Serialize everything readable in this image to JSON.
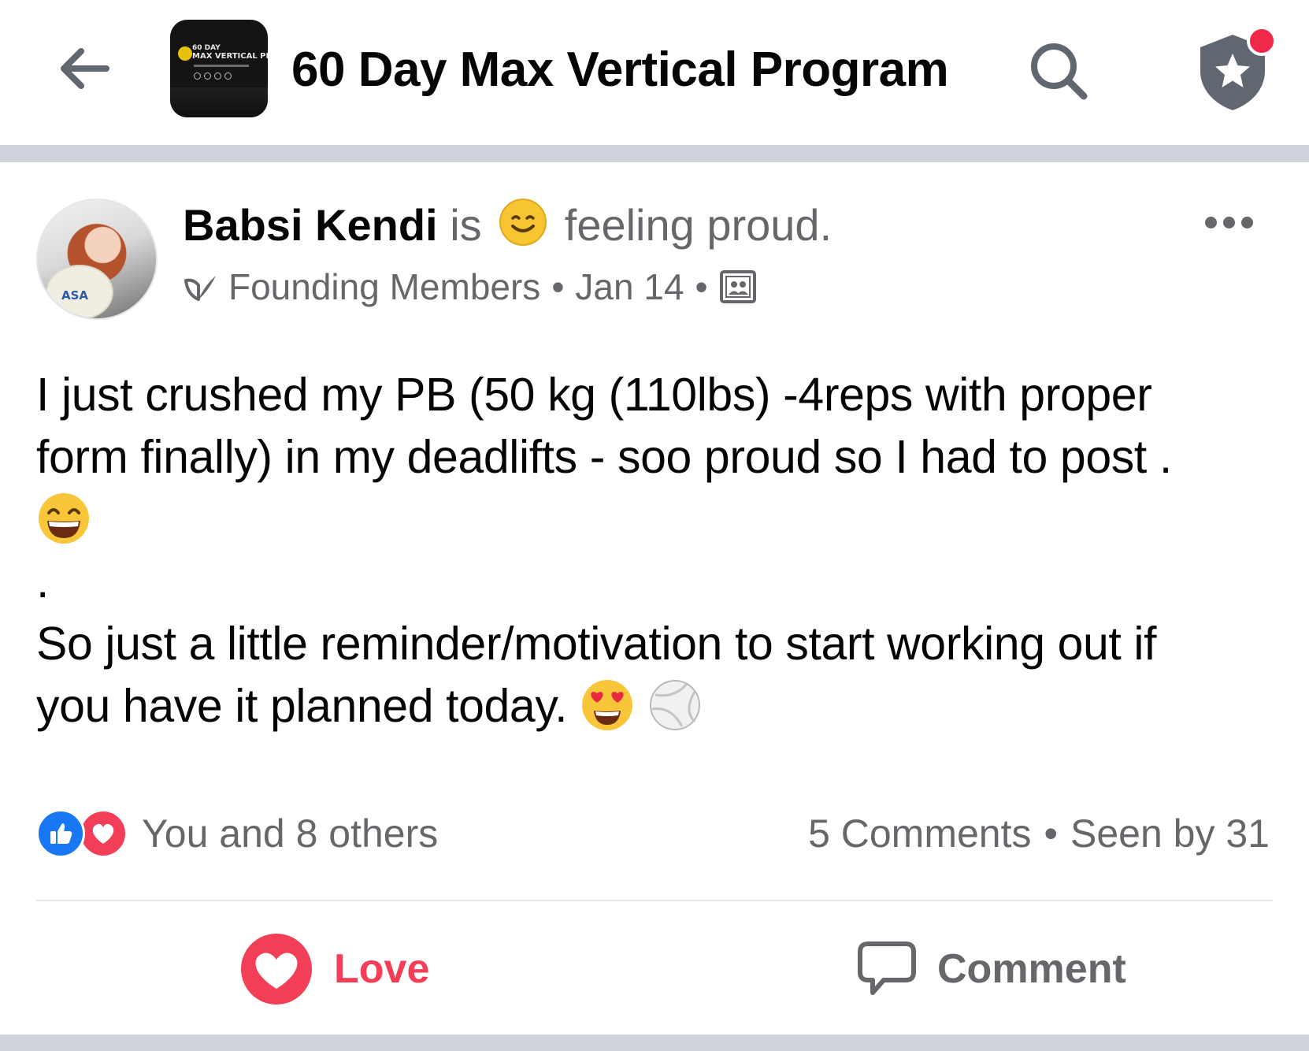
{
  "header": {
    "back_icon": "arrow-left-icon",
    "group_thumbnail": {
      "line1": "60 DAY",
      "line2": "MAX VERTICAL PROGRA"
    },
    "group_title": "60 Day Max Vertical Program",
    "search_icon": "search-icon",
    "shield_icon": "shield-star-icon",
    "notification_dot_color": "#f02849"
  },
  "post": {
    "author": "Babsi Kendi",
    "is_text": "is",
    "feeling_icon": "smiling-face-icon",
    "feeling": "feeling proud.",
    "member_badge_icon": "founding-member-icon",
    "member_group": "Founding Members",
    "separator": "•",
    "date": "Jan 14",
    "privacy_icon": "group-members-icon",
    "avatar_text": "ASA",
    "body_lines": [
      "I just crushed my PB (50 kg (110lbs) -4reps with proper",
      "form finally) in my deadlifts - soo proud so I had to post .",
      ".",
      "So just a little reminder/motivation to start working out if",
      "you have it planned today."
    ],
    "body_emojis": [
      "grinning-squinting-face-icon",
      "heart-eyes-face-icon",
      "volleyball-icon"
    ]
  },
  "reactions": {
    "like_icon": "like-thumb-icon",
    "love_icon": "love-heart-icon",
    "summary": "You and 8 others",
    "comments": "5 Comments",
    "separator": "•",
    "seen_by": "Seen by 31"
  },
  "actions": {
    "love_label": "Love",
    "comment_label": "Comment"
  },
  "colors": {
    "text_primary": "#050505",
    "text_secondary": "#65676b",
    "like_blue": "#1877f2",
    "love_red": "#f33e58",
    "divider": "#d0d4da"
  }
}
